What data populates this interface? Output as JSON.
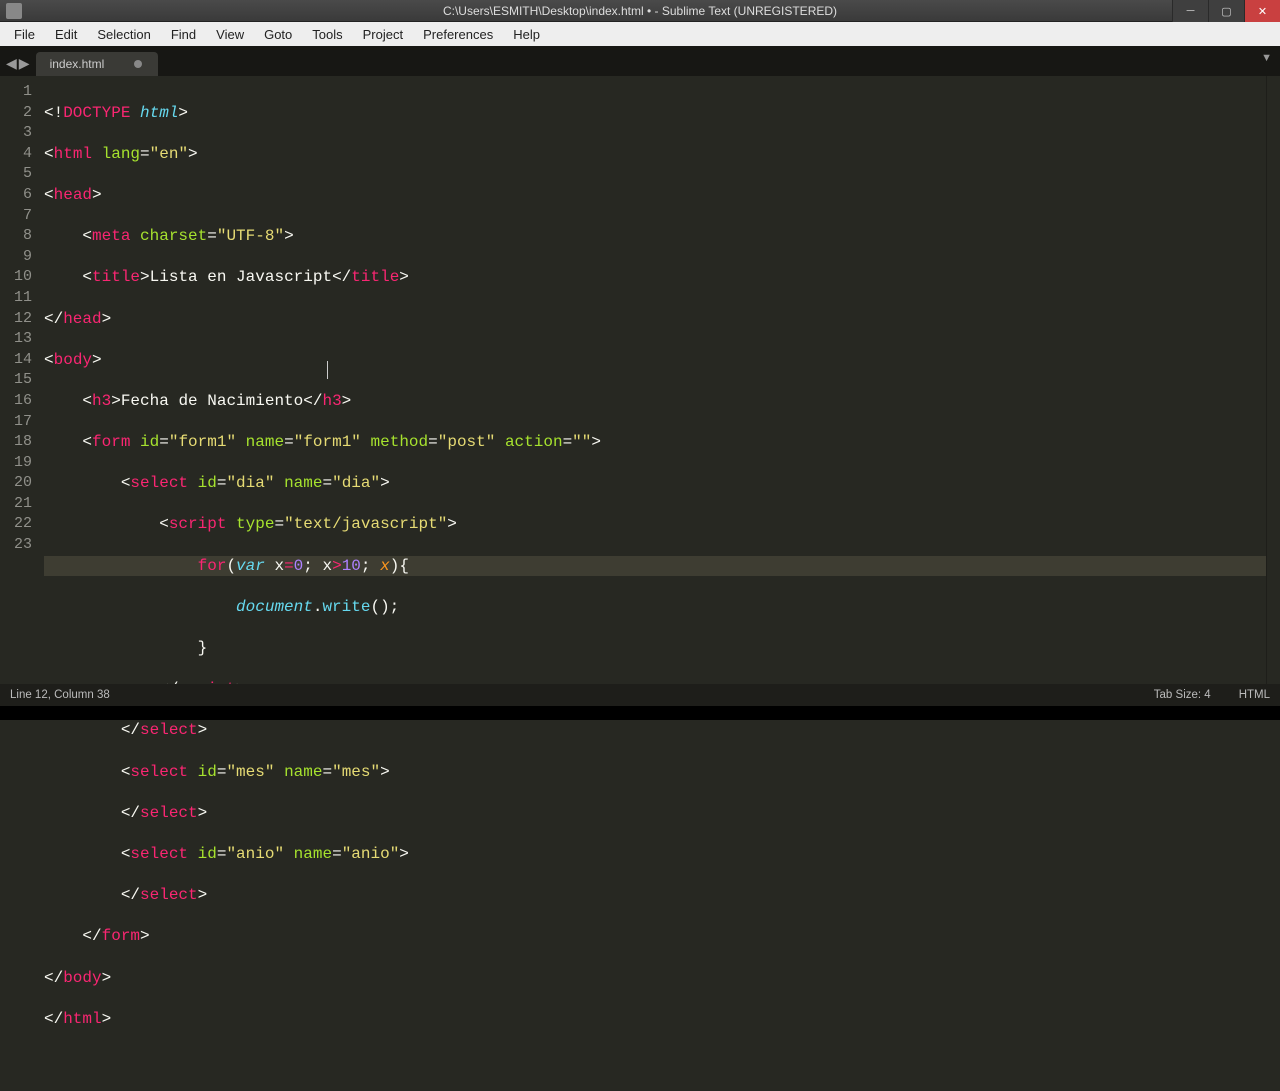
{
  "window": {
    "title": "C:\\Users\\ESMITH\\Desktop\\index.html • - Sublime Text (UNREGISTERED)"
  },
  "menu": {
    "file": "File",
    "edit": "Edit",
    "selection": "Selection",
    "find": "Find",
    "view": "View",
    "goto": "Goto",
    "tools": "Tools",
    "project": "Project",
    "preferences": "Preferences",
    "help": "Help"
  },
  "tab": {
    "name": "index.html"
  },
  "lines": {
    "l1": "1",
    "l2": "2",
    "l3": "3",
    "l4": "4",
    "l5": "5",
    "l6": "6",
    "l7": "7",
    "l8": "8",
    "l9": "9",
    "l10": "10",
    "l11": "11",
    "l12": "12",
    "l13": "13",
    "l14": "14",
    "l15": "15",
    "l16": "16",
    "l17": "17",
    "l18": "18",
    "l19": "19",
    "l20": "20",
    "l21": "21",
    "l22": "22",
    "l23": "23"
  },
  "code": {
    "doctype_open": "<!",
    "doctype_kw": "DOCTYPE ",
    "doctype_html": "html",
    "doctype_close": ">",
    "lt": "<",
    "gt": ">",
    "lts": "</",
    "html": "html",
    "lang_attr": " lang",
    "eq": "=",
    "lang_val": "\"en\"",
    "head": "head",
    "indent1": "    ",
    "indent2": "        ",
    "indent3": "            ",
    "indent4": "                ",
    "indent5": "                    ",
    "indent6": "                        ",
    "meta": "meta",
    "charset_attr": " charset",
    "charset_val": "\"UTF-8\"",
    "title": "title",
    "title_text": "Lista en Javascript",
    "body": "body",
    "h3": "h3",
    "h3_text": "Fecha de Nacimiento",
    "form": "form",
    "id_attr": " id",
    "name_attr": " name",
    "method_attr": " method",
    "action_attr": " action",
    "form_id": "\"form1\"",
    "form_name": "\"form1\"",
    "form_method": "\"post\"",
    "form_action": "\"\"",
    "select": "select",
    "dia": "\"dia\"",
    "mes": "\"mes\"",
    "anio": "\"anio\"",
    "script": "script",
    "type_attr": " type",
    "type_val": "\"text/javascript\"",
    "for": "for",
    "lp": "(",
    "rp": ")",
    "var": "var ",
    "x": "x",
    "assign": "=",
    "zero": "0",
    "semi": "; ",
    "gt_op": ">",
    "ten": "10",
    "lb": "{",
    "rb": "}",
    "document": "document",
    "dot": ".",
    "write": "write",
    "empty_args": "()",
    "end": ";"
  },
  "status": {
    "pos": "Line 12, Column 38",
    "tabsize": "Tab Size: 4",
    "syntax": "HTML"
  }
}
